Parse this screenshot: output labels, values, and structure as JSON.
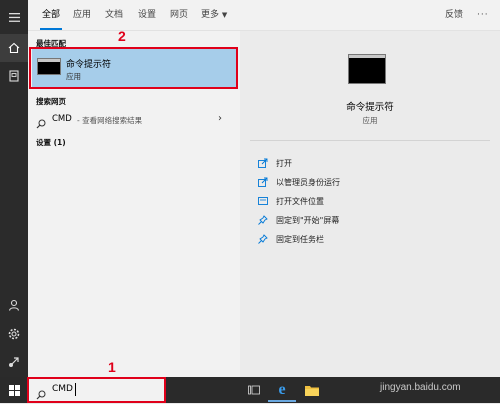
{
  "tabs": [
    "全部",
    "应用",
    "文档",
    "设置",
    "网页",
    "更多"
  ],
  "feedback_label": "反馈",
  "best_match": {
    "header": "最佳匹配",
    "title": "命令提示符",
    "subtitle": "应用"
  },
  "search_web": {
    "header": "搜索网页",
    "query": "CMD",
    "hint": "- 查看网络搜索结果"
  },
  "settings_header": "设置 (1)",
  "detail": {
    "title": "命令提示符",
    "subtitle": "应用",
    "actions": [
      {
        "label": "打开",
        "icon": "open-icon"
      },
      {
        "label": "以管理员身份运行",
        "icon": "admin-shield-icon"
      },
      {
        "label": "打开文件位置",
        "icon": "folder-location-icon"
      },
      {
        "label": "固定到\"开始\"屏幕",
        "icon": "pin-icon"
      },
      {
        "label": "固定到任务栏",
        "icon": "pin-icon"
      }
    ]
  },
  "search_box": {
    "value": "CMD"
  },
  "annotations": {
    "step1": "1",
    "step2": "2"
  },
  "watermark": "jingyan.baidu.com",
  "colors": {
    "accent": "#0078d7",
    "selected": "#a6cdea",
    "annotation_red": "#e0001a"
  }
}
